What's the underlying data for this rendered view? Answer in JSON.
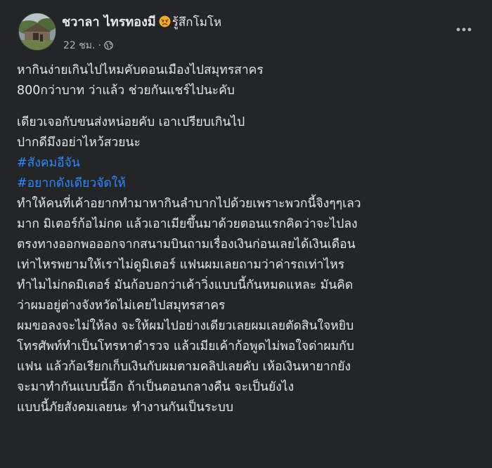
{
  "post": {
    "author": "ชวาลา ไทรทองมี",
    "feeling_icon": "angry-face-emoji",
    "feeling": "รู้สึกโมโห",
    "timestamp": "22 ชม.",
    "separator": "·",
    "privacy_icon": "globe-icon",
    "more_icon": "more-options-icon",
    "lines_para1": [
      "หากินง่ายเกินไปไหมคับดอนเมืองไปสมุทรสาคร",
      "800กว่าบาท ว่าแล้ว ช่วยกันแชร์ไปนะคับ"
    ],
    "lines_para2": [
      "เดียวเจอกับขนส่งหน่อยคับ เอาเปรียบเกินไป",
      "ปากดีมึงอย่าไหว้สวยนะ"
    ],
    "hashtags": [
      "#สังคมอีจัน",
      "#อยากดังเดียวจัดให้"
    ],
    "lines_para3": [
      "ทำให้คนที่เค้าอยากทำมาหากินลำบากไปด้วยเพราะพวกนี้จิงๆๆเลว",
      "มาก มิเตอร์ก้อไม่กด แล้วเอาเมียขึ้นมาด้วยตอนแรกคิดว่าจะไปลง",
      "ตรงทางออกพอออกจากสนามบินถามเรื่องเงินก่อนเลยได้เงินเดือน",
      "เท่าไหรพยามให้เราไม่ดูมิเตอร์ แฟนผมเลยถามว่าค่ารถเท่าไหร",
      "ทำไมไม่กดมิเตอร์ มันก้อบอกว่าเค้าวิ่งแบบนี้กันหมดแหละ มันคิด",
      "ว่าผมอยู่ต่างจังหวัดไม่เคยไปสมุทรสาคร",
      "ผมขอลงจะไม่ให้ลง จะให้ผมไปอย่างเดียวเลยผมเลยตัดสินใจหยิบ",
      "โทรศัพท์ทำเป็นโทรหาตำรวจ แล้วเมียเค้าก้อพูดไม่พอใจด่าผมกับ",
      "แฟน แล้วก้อเรียกเก็บเงินกับผมตามคลิปเลยคับ เห้อเงินหายากยัง",
      "จะมาทำกันแบบนี้อีก  ถ้าเป็นตอนกลางคืน จะเป็นยังไง",
      "แบบนี้ภัยสังคมเลยนะ ทำงานกันเป็นระบบ"
    ]
  },
  "colors": {
    "background": "#242526",
    "text": "#e4e6eb",
    "secondary_text": "#b0b3b8",
    "hashtag": "#2d88ff"
  }
}
